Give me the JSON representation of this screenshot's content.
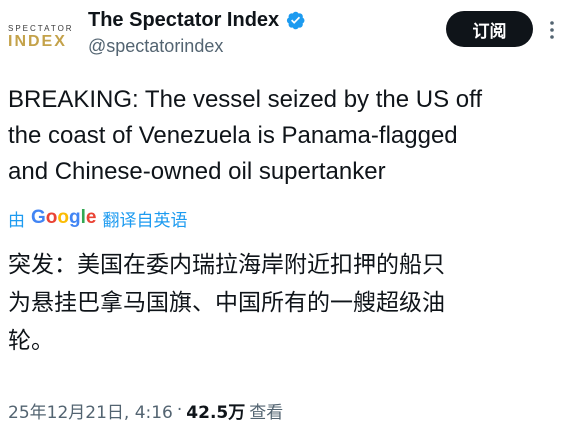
{
  "account": {
    "avatar_top": "SPECTATOR",
    "avatar_bottom": "INDEX",
    "display_name": "The Spectator Index",
    "handle": "@spectatorindex"
  },
  "actions": {
    "subscribe_label": "订阅"
  },
  "tweet": {
    "lines": [
      "BREAKING: The vessel seized by the US off",
      "the coast of Venezuela is Panama-flagged",
      "and Chinese-owned oil supertanker"
    ]
  },
  "translation": {
    "by_label": "由",
    "provider_letters": [
      "G",
      "o",
      "o",
      "g",
      "l",
      "e"
    ],
    "action_label": "翻译自英语",
    "lines": [
      "突发：美国在委内瑞拉海岸附近扣押的船只",
      "为悬挂巴拿马国旗、中国所有的一艘超级油",
      "轮。"
    ]
  },
  "meta": {
    "timestamp": "25年12月21日, 4:16",
    "separator": "·",
    "views_count": "42.5万",
    "views_label": "查看"
  },
  "colors": {
    "accent": "#1d9bf0",
    "text_primary": "#0f1419",
    "text_secondary": "#536471",
    "button_bg": "#0f1419",
    "avatar_gold": "#c4a24a"
  },
  "icons": {
    "verified": "verified-badge-icon",
    "more": "more-vertical-icon"
  }
}
